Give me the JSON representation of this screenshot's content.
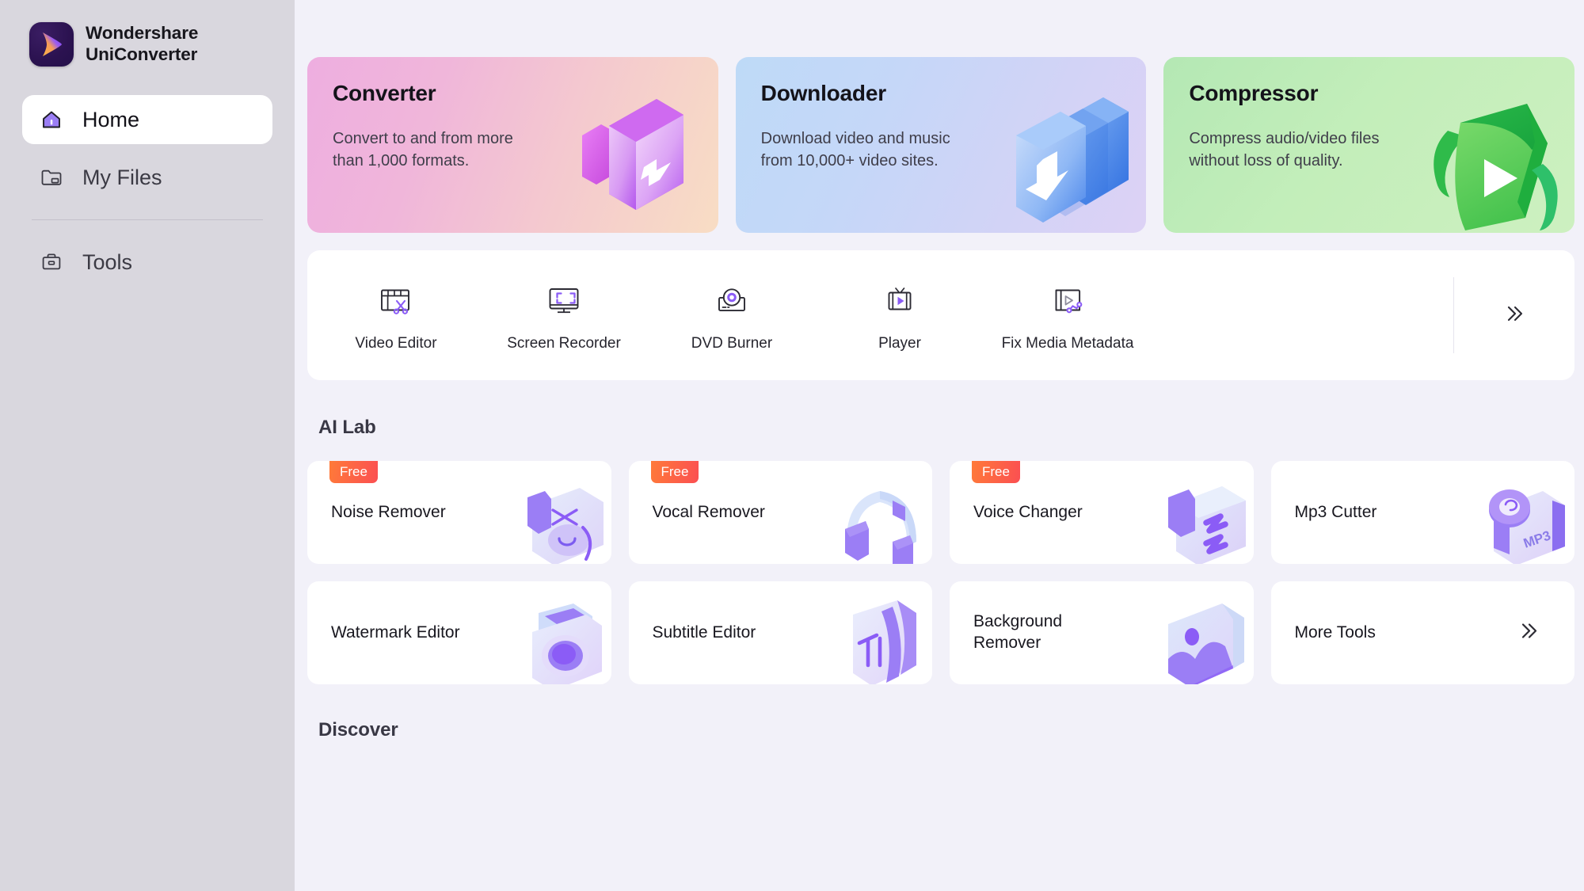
{
  "sidebar": {
    "brand": {
      "line1": "Wondershare",
      "line2": "UniConverter",
      "logo_icon": "play-logo-icon"
    },
    "items": [
      {
        "label": "Home",
        "icon": "home-icon",
        "active": true
      },
      {
        "label": "My Files",
        "icon": "folder-icon",
        "active": false
      },
      {
        "label": "Tools",
        "icon": "toolbox-icon",
        "active": false
      }
    ]
  },
  "hero": {
    "cards": [
      {
        "title": "Converter",
        "desc": "Convert to and from more than 1,000 formats.",
        "art": "converter-art-icon",
        "accent": "#e8a7dd"
      },
      {
        "title": "Downloader",
        "desc": "Download video and music from 10,000+ video sites.",
        "art": "downloader-art-icon",
        "accent": "#4e8ef0"
      },
      {
        "title": "Compressor",
        "desc": "Compress audio/video files without loss of quality.",
        "art": "compressor-art-icon",
        "accent": "#3bbd48"
      }
    ]
  },
  "tools": {
    "items": [
      {
        "label": "Video Editor",
        "icon": "film-scissors-icon"
      },
      {
        "label": "Screen Recorder",
        "icon": "monitor-capture-icon"
      },
      {
        "label": "DVD Burner",
        "icon": "disc-burner-icon"
      },
      {
        "label": "Player",
        "icon": "tv-play-icon"
      },
      {
        "label": "Fix Media Metadata",
        "icon": "media-metadata-icon"
      }
    ],
    "more_icon": "double-chevron-right-icon"
  },
  "ai_lab": {
    "title": "AI Lab",
    "badge_label": "Free",
    "cards": [
      {
        "title": "Noise Remover",
        "free": true,
        "art": "noise-remover-art-icon"
      },
      {
        "title": "Vocal Remover",
        "free": true,
        "art": "headphones-art-icon"
      },
      {
        "title": "Voice Changer",
        "free": true,
        "art": "voice-changer-art-icon"
      },
      {
        "title": "Mp3 Cutter",
        "free": false,
        "art": "mp3-art-icon"
      },
      {
        "title": "Watermark Editor",
        "free": false,
        "art": "camera-art-icon"
      },
      {
        "title": "Subtitle Editor",
        "free": false,
        "art": "subtitle-art-icon"
      },
      {
        "title": "Background Remover",
        "free": false,
        "art": "image-bg-art-icon"
      },
      {
        "title": "More Tools",
        "free": false,
        "art": "double-chevron-right-icon"
      }
    ]
  },
  "discover": {
    "title": "Discover"
  },
  "colors": {
    "sidebar_bg": "#d9d7de",
    "main_bg": "#f2f1f9",
    "card_bg": "#ffffff",
    "accent_purple": "#8b5cf6",
    "badge_from": "#ff7a39",
    "badge_to": "#fb4f52"
  }
}
